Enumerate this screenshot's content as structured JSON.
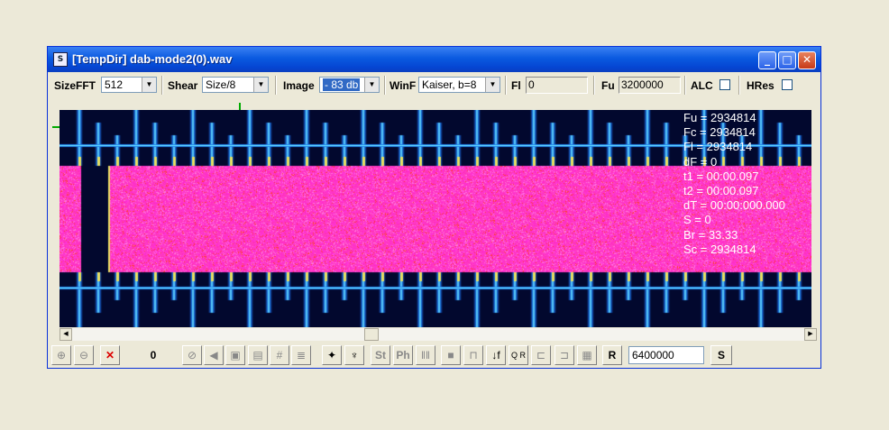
{
  "window": {
    "title": "[TempDir] dab-mode2(0).wav",
    "icon": "spectrum-app-icon"
  },
  "toolbar": {
    "sizefft_label": "SizeFFT",
    "sizefft_value": "512",
    "shear_label": "Shear",
    "shear_value": "Size/8",
    "image_label": "Image",
    "image_value": "- 83 db",
    "winf_label": "WinF",
    "winf_value": "Kaiser, b=8",
    "fl_label": "Fl",
    "fl_value": "0",
    "fu_label": "Fu",
    "fu_value": "3200000",
    "alc_label": "ALC",
    "alc_checked": false,
    "hres_label": "HRes",
    "hres_checked": false
  },
  "readout": [
    "Fu = 2934814",
    "Fc = 2934814",
    "Fl = 2934814",
    "dF = 0",
    "t1 = 00:00.097",
    "t2 = 00:00.097",
    "dT = 00:00:000.000",
    "S = 0",
    "Br = 33.33",
    "Sc = 2934814"
  ],
  "bottombar": {
    "counter_value": "0",
    "st_label": "St",
    "ph_label": "Ph",
    "r_label": "R",
    "s_label": "S",
    "qr_label": "Q R",
    "freq_value": "6400000"
  },
  "colors": {
    "titlebar": "#0a5ae0",
    "background_spectrum": "#02082e",
    "noise_band": "#ff2fb8",
    "line_cyan": "#36e8ff"
  }
}
